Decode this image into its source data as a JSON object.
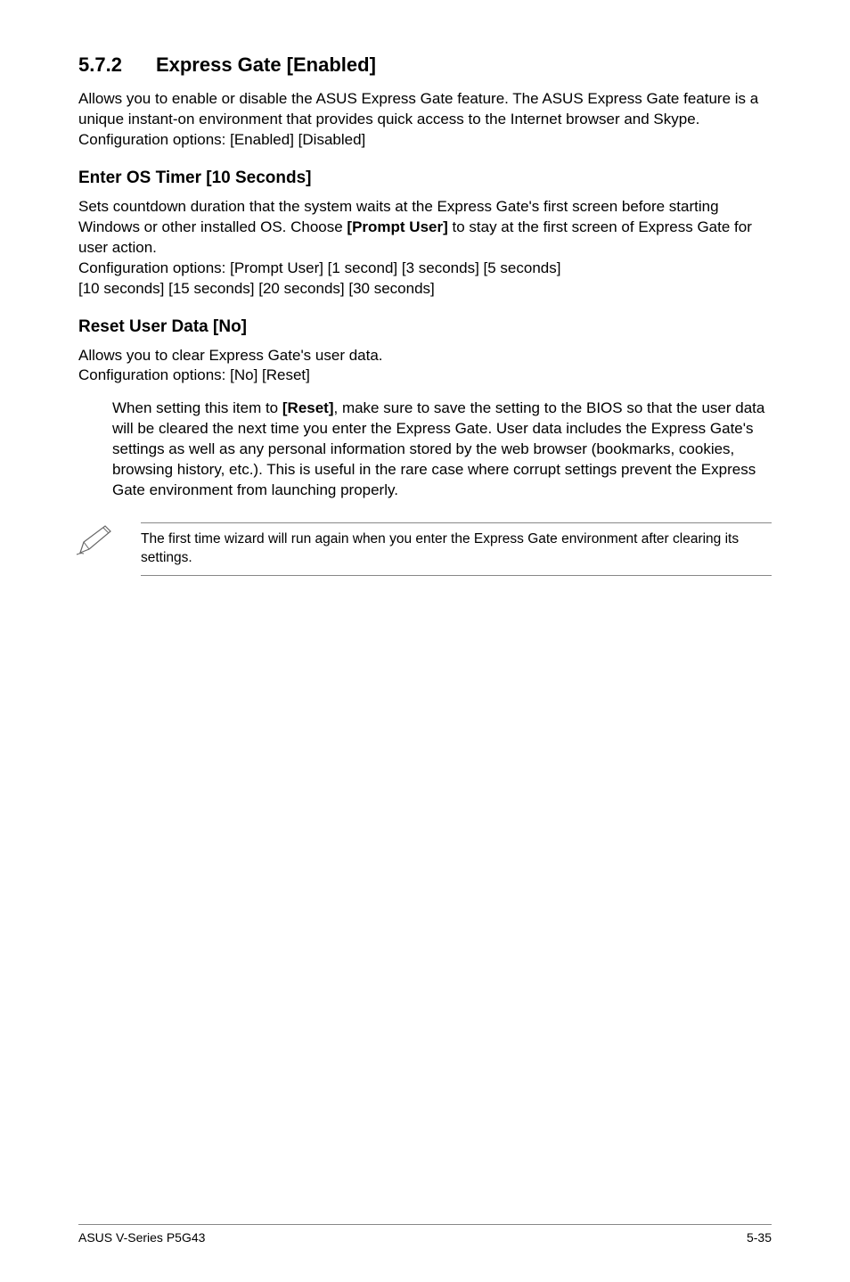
{
  "section": {
    "number": "5.7.2",
    "title": "Express Gate [Enabled]",
    "intro": "Allows you to enable or disable the ASUS Express Gate feature. The ASUS Express Gate feature is a unique instant-on environment that provides quick access to the Internet browser and Skype. Configuration options: [Enabled] [Disabled]"
  },
  "os_timer": {
    "heading": "Enter OS Timer [10 Seconds]",
    "text_before": "Sets countdown duration that the system waits at the Express Gate's first screen before starting Windows or other installed OS. Choose ",
    "bold": "[Prompt User]",
    "text_after": " to stay at the first screen of Express Gate for user action.",
    "config_line1": "Configuration options: [Prompt User] [1 second] [3 seconds] [5 seconds]",
    "config_line2": "[10 seconds] [15 seconds] [20 seconds] [30 seconds]"
  },
  "reset": {
    "heading": "Reset User Data [No]",
    "line1": "Allows you to clear Express Gate's user data.",
    "line2": "Configuration options: [No] [Reset]",
    "block_before": "When setting this item to ",
    "block_bold": "[Reset]",
    "block_after": ", make sure to save the setting to the BIOS so that the user data will be cleared the next time you enter the Express Gate. User data includes the Express Gate's settings as well as any personal information stored by the web browser (bookmarks, cookies, browsing history, etc.). This is useful in the rare case where corrupt settings prevent the Express Gate environment from launching properly."
  },
  "note": {
    "text": "The first time wizard will run again when you enter the Express Gate environment after clearing its settings."
  },
  "footer": {
    "left": "ASUS V-Series P5G43",
    "right": "5-35"
  }
}
